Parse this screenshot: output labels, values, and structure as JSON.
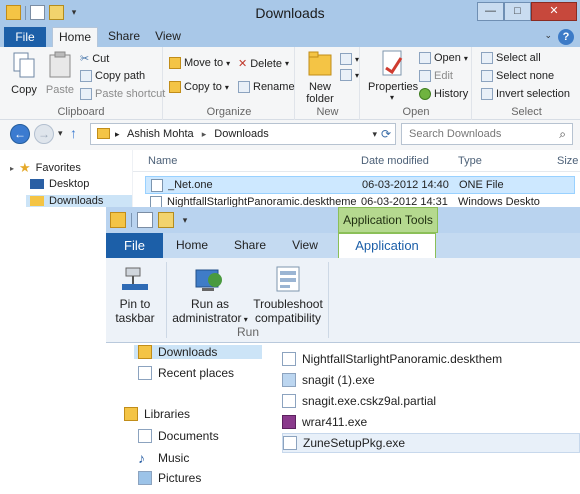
{
  "window": {
    "title": "Downloads",
    "controls": {
      "minimize": "—",
      "maximize": "□",
      "close": "✕"
    }
  },
  "ribbon_tabs": {
    "file": "File",
    "home": "Home",
    "share": "Share",
    "view": "View"
  },
  "ribbon_groups": {
    "clipboard": {
      "label": "Clipboard",
      "copy": "Copy",
      "paste": "Paste",
      "cut": "Cut",
      "copy_path": "Copy path",
      "paste_shortcut": "Paste shortcut"
    },
    "organize": {
      "label": "Organize",
      "move_to": "Move to",
      "copy_to": "Copy to",
      "delete": "Delete",
      "rename": "Rename"
    },
    "new": {
      "label": "New",
      "new_folder_line1": "New",
      "new_folder_line2": "folder"
    },
    "open": {
      "label": "Open",
      "properties": "Properties",
      "open": "Open",
      "edit": "Edit",
      "history": "History"
    },
    "select": {
      "label": "Select",
      "select_all": "Select all",
      "select_none": "Select none",
      "invert_selection": "Invert selection"
    }
  },
  "address_bar": {
    "part1": "Ashish Mohta",
    "part2": "Downloads",
    "separator": "▸"
  },
  "search": {
    "placeholder": "Search Downloads"
  },
  "nav_pane": {
    "favorites": "Favorites",
    "desktop": "Desktop",
    "downloads": "Downloads"
  },
  "columns": {
    "name": "Name",
    "date_modified": "Date modified",
    "type": "Type",
    "size": "Size"
  },
  "files": [
    {
      "name": "_Net.one",
      "date": "06-03-2012 14:40",
      "type": "ONE File"
    },
    {
      "name": "NightfallStarlightPanoramic.deskthemep",
      "date": "06-03-2012 14:31",
      "type": "Windows Deskto"
    }
  ],
  "zoom": {
    "context_tab": "Application Tools",
    "tabs": {
      "file": "File",
      "home": "Home",
      "share": "Share",
      "view": "View",
      "application": "Application"
    },
    "buttons": {
      "pin_line1": "Pin to",
      "pin_line2": "taskbar",
      "run_admin_line1": "Run as",
      "run_admin_line2": "administrator",
      "troubleshoot_line1": "Troubleshoot",
      "troubleshoot_line2": "compatibility"
    },
    "group_label": "Run",
    "nav": {
      "downloads": "Downloads",
      "recent_places": "Recent places",
      "libraries": "Libraries",
      "documents": "Documents",
      "music": "Music",
      "pictures": "Pictures"
    },
    "files": [
      "NightfallStarlightPanoramic.deskthem",
      "snagit (1).exe",
      "snagit.exe.cskz9al.partial",
      "wrar411.exe",
      "ZuneSetupPkg.exe"
    ]
  }
}
